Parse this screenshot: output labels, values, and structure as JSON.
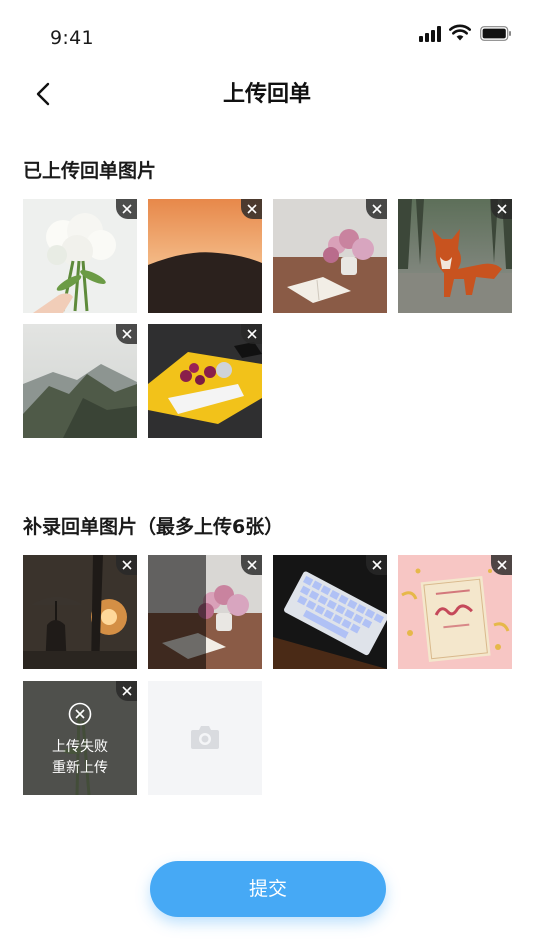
{
  "status_bar": {
    "time": "9:41",
    "signal_icon": "cellular-signal-icon",
    "wifi_icon": "wifi-icon",
    "battery_icon": "battery-icon"
  },
  "header": {
    "title": "上传回单",
    "back_icon": "chevron-left-icon"
  },
  "uploaded_section": {
    "title": "已上传回单图片",
    "images": [
      {
        "name": "white-peony-bouquet"
      },
      {
        "name": "sunset-hill"
      },
      {
        "name": "pink-flowers-book"
      },
      {
        "name": "red-fox"
      },
      {
        "name": "mountain-valley"
      },
      {
        "name": "purple-balloon-dogs"
      }
    ]
  },
  "supplement_section": {
    "title": "补录回单图片（最多上传6张）",
    "images": [
      {
        "name": "umbrella-sunset-street"
      },
      {
        "name": "pink-flowers-book-dark"
      },
      {
        "name": "rgb-keyboard"
      },
      {
        "name": "rest-card-pink"
      },
      {
        "name": "failed-upload",
        "status": "failed",
        "failed_line1": "上传失败",
        "failed_line2": "重新上传"
      }
    ],
    "add_icon": "camera-icon"
  },
  "submit_label": "提交",
  "colors": {
    "accent": "#46a9f5",
    "add_tile_bg": "#f4f5f7"
  }
}
